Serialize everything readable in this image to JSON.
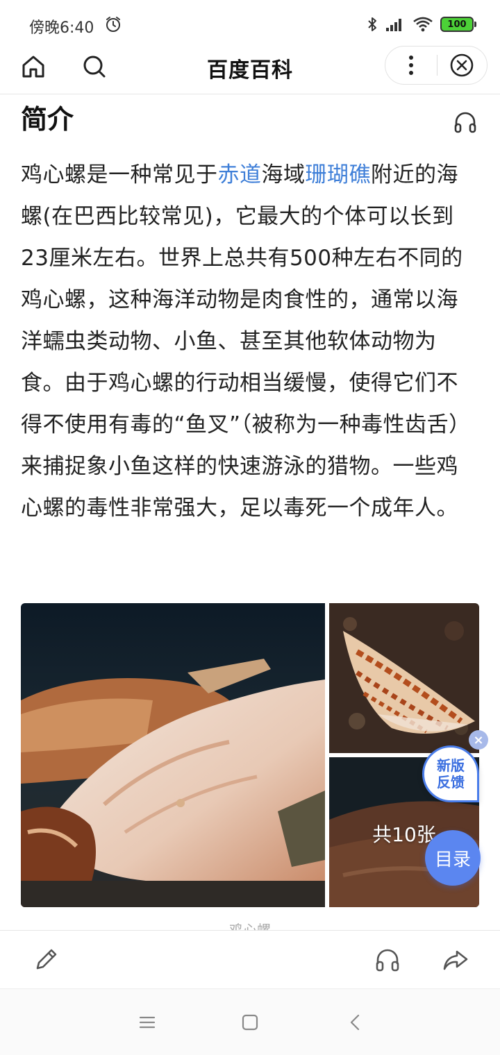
{
  "status_bar": {
    "time": "傍晚6:40",
    "battery": "100"
  },
  "top_nav": {
    "title": "百度百科",
    "icons": [
      "home-icon",
      "search-icon",
      "more-vertical-icon",
      "close-circle-icon"
    ]
  },
  "section": {
    "title": "简介",
    "audio_icon": "headphones-icon"
  },
  "intro": {
    "t1": "鸡心螺是一种常见于",
    "link1": "赤道",
    "t2": "海域",
    "link2": "珊瑚礁",
    "t3": "附近的海螺(在巴西比较常见)，它最大的个体可以长到23厘米左右。世界上总共有500种左右不同的鸡心螺，这种海洋动物是肉食性的，通常以海洋蠕虫类动物、小鱼、甚至其他软体动物为食。由于鸡心螺的行动相当缓慢，使得它们不得不使用有毒的“鱼叉”（被称为一种毒性齿舌）来捕捉象小鱼这样的快速游泳的猎物。一些鸡心螺的毒性非常强大，足以毒死一个成年人。"
  },
  "gallery": {
    "count_label": "共10张",
    "caption_peek": "鸡心螺"
  },
  "floating": {
    "feedback_line1": "新版",
    "feedback_line2": "反馈",
    "feedback_close": "×",
    "toc_label": "目录"
  },
  "bottom_toolbar": {
    "icons": [
      "edit-icon",
      "headphones-icon",
      "share-icon"
    ]
  },
  "colors": {
    "link": "#3f7fd8",
    "accent": "#5b86f0",
    "battery": "#4cd137"
  }
}
